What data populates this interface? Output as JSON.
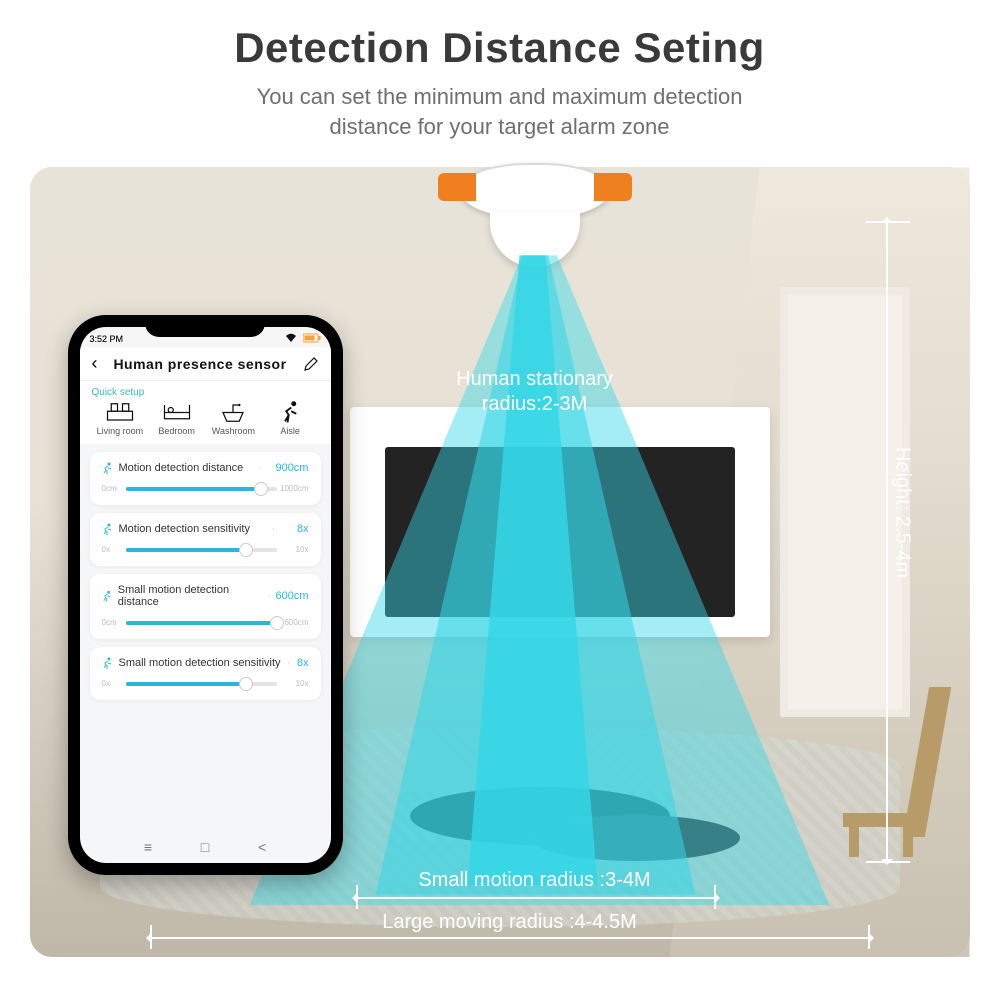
{
  "header": {
    "title": "Detection Distance Seting",
    "subtitle_l1": "You can set the minimum and maximum detection",
    "subtitle_l2": "distance for your target alarm zone"
  },
  "annotations": {
    "stationary_l1": "Human stationary",
    "stationary_l2": "radius:2-3M",
    "height": "Height: 2.5-4m",
    "small": "Small motion radius :3-4M",
    "large": "Large moving radius :4-4.5M"
  },
  "phone": {
    "status": {
      "time": "3:52 PM",
      "wifi": "wifi-icon",
      "battery": "battery-icon"
    },
    "header": {
      "back": "‹",
      "title": "Human presence sensor",
      "edit": "edit-icon"
    },
    "quick_setup_label": "Quick setup",
    "quick_items": [
      {
        "label": "Living room",
        "icon": "living-room-icon"
      },
      {
        "label": "Bedroom",
        "icon": "bed-icon"
      },
      {
        "label": "Washroom",
        "icon": "sink-icon"
      },
      {
        "label": "Aisle",
        "icon": "running-person-icon"
      }
    ],
    "cards": [
      {
        "name": "Motion detection distance",
        "value": "900cm",
        "min": "0cm",
        "max": "1000cm",
        "pct": 90
      },
      {
        "name": "Motion detection sensitivity",
        "value": "8x",
        "min": "0x",
        "max": "10x",
        "pct": 80
      },
      {
        "name": "Small motion detection distance",
        "value": "600cm",
        "min": "0cm",
        "max": "600cm",
        "pct": 100
      },
      {
        "name": "Small motion detection sensitivity",
        "value": "8x",
        "min": "0x",
        "max": "10x",
        "pct": 80
      }
    ],
    "nav": [
      "≡",
      "□",
      "<"
    ]
  }
}
